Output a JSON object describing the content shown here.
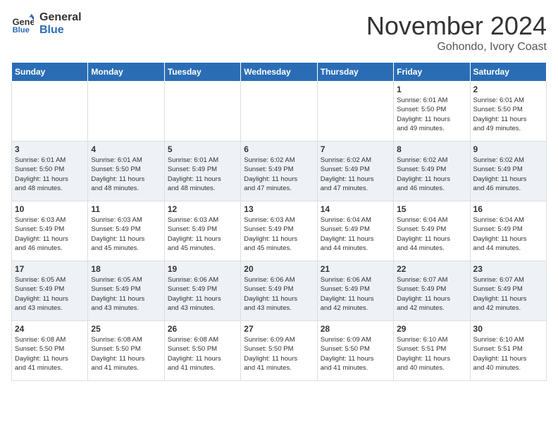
{
  "header": {
    "logo_line1": "General",
    "logo_line2": "Blue",
    "month": "November 2024",
    "location": "Gohondo, Ivory Coast"
  },
  "days_of_week": [
    "Sunday",
    "Monday",
    "Tuesday",
    "Wednesday",
    "Thursday",
    "Friday",
    "Saturday"
  ],
  "weeks": [
    [
      {
        "day": "",
        "info": ""
      },
      {
        "day": "",
        "info": ""
      },
      {
        "day": "",
        "info": ""
      },
      {
        "day": "",
        "info": ""
      },
      {
        "day": "",
        "info": ""
      },
      {
        "day": "1",
        "info": "Sunrise: 6:01 AM\nSunset: 5:50 PM\nDaylight: 11 hours\nand 49 minutes."
      },
      {
        "day": "2",
        "info": "Sunrise: 6:01 AM\nSunset: 5:50 PM\nDaylight: 11 hours\nand 49 minutes."
      }
    ],
    [
      {
        "day": "3",
        "info": "Sunrise: 6:01 AM\nSunset: 5:50 PM\nDaylight: 11 hours\nand 48 minutes."
      },
      {
        "day": "4",
        "info": "Sunrise: 6:01 AM\nSunset: 5:50 PM\nDaylight: 11 hours\nand 48 minutes."
      },
      {
        "day": "5",
        "info": "Sunrise: 6:01 AM\nSunset: 5:49 PM\nDaylight: 11 hours\nand 48 minutes."
      },
      {
        "day": "6",
        "info": "Sunrise: 6:02 AM\nSunset: 5:49 PM\nDaylight: 11 hours\nand 47 minutes."
      },
      {
        "day": "7",
        "info": "Sunrise: 6:02 AM\nSunset: 5:49 PM\nDaylight: 11 hours\nand 47 minutes."
      },
      {
        "day": "8",
        "info": "Sunrise: 6:02 AM\nSunset: 5:49 PM\nDaylight: 11 hours\nand 46 minutes."
      },
      {
        "day": "9",
        "info": "Sunrise: 6:02 AM\nSunset: 5:49 PM\nDaylight: 11 hours\nand 46 minutes."
      }
    ],
    [
      {
        "day": "10",
        "info": "Sunrise: 6:03 AM\nSunset: 5:49 PM\nDaylight: 11 hours\nand 46 minutes."
      },
      {
        "day": "11",
        "info": "Sunrise: 6:03 AM\nSunset: 5:49 PM\nDaylight: 11 hours\nand 45 minutes."
      },
      {
        "day": "12",
        "info": "Sunrise: 6:03 AM\nSunset: 5:49 PM\nDaylight: 11 hours\nand 45 minutes."
      },
      {
        "day": "13",
        "info": "Sunrise: 6:03 AM\nSunset: 5:49 PM\nDaylight: 11 hours\nand 45 minutes."
      },
      {
        "day": "14",
        "info": "Sunrise: 6:04 AM\nSunset: 5:49 PM\nDaylight: 11 hours\nand 44 minutes."
      },
      {
        "day": "15",
        "info": "Sunrise: 6:04 AM\nSunset: 5:49 PM\nDaylight: 11 hours\nand 44 minutes."
      },
      {
        "day": "16",
        "info": "Sunrise: 6:04 AM\nSunset: 5:49 PM\nDaylight: 11 hours\nand 44 minutes."
      }
    ],
    [
      {
        "day": "17",
        "info": "Sunrise: 6:05 AM\nSunset: 5:49 PM\nDaylight: 11 hours\nand 43 minutes."
      },
      {
        "day": "18",
        "info": "Sunrise: 6:05 AM\nSunset: 5:49 PM\nDaylight: 11 hours\nand 43 minutes."
      },
      {
        "day": "19",
        "info": "Sunrise: 6:06 AM\nSunset: 5:49 PM\nDaylight: 11 hours\nand 43 minutes."
      },
      {
        "day": "20",
        "info": "Sunrise: 6:06 AM\nSunset: 5:49 PM\nDaylight: 11 hours\nand 43 minutes."
      },
      {
        "day": "21",
        "info": "Sunrise: 6:06 AM\nSunset: 5:49 PM\nDaylight: 11 hours\nand 42 minutes."
      },
      {
        "day": "22",
        "info": "Sunrise: 6:07 AM\nSunset: 5:49 PM\nDaylight: 11 hours\nand 42 minutes."
      },
      {
        "day": "23",
        "info": "Sunrise: 6:07 AM\nSunset: 5:49 PM\nDaylight: 11 hours\nand 42 minutes."
      }
    ],
    [
      {
        "day": "24",
        "info": "Sunrise: 6:08 AM\nSunset: 5:50 PM\nDaylight: 11 hours\nand 41 minutes."
      },
      {
        "day": "25",
        "info": "Sunrise: 6:08 AM\nSunset: 5:50 PM\nDaylight: 11 hours\nand 41 minutes."
      },
      {
        "day": "26",
        "info": "Sunrise: 6:08 AM\nSunset: 5:50 PM\nDaylight: 11 hours\nand 41 minutes."
      },
      {
        "day": "27",
        "info": "Sunrise: 6:09 AM\nSunset: 5:50 PM\nDaylight: 11 hours\nand 41 minutes."
      },
      {
        "day": "28",
        "info": "Sunrise: 6:09 AM\nSunset: 5:50 PM\nDaylight: 11 hours\nand 41 minutes."
      },
      {
        "day": "29",
        "info": "Sunrise: 6:10 AM\nSunset: 5:51 PM\nDaylight: 11 hours\nand 40 minutes."
      },
      {
        "day": "30",
        "info": "Sunrise: 6:10 AM\nSunset: 5:51 PM\nDaylight: 11 hours\nand 40 minutes."
      }
    ]
  ],
  "colors": {
    "header_bg": "#2a6db5",
    "header_text": "#ffffff",
    "row_odd": "#ffffff",
    "row_even": "#eef2f7"
  }
}
